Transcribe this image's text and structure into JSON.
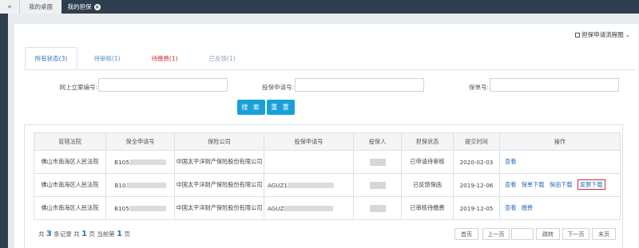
{
  "topbar": {
    "back_icon": "«",
    "home_tab": "我的桌面",
    "active_tab": "我的担保",
    "close_icon": "×"
  },
  "flow_link": "担保申请流程图",
  "status_tabs": [
    {
      "label": "所有状态(3)"
    },
    {
      "label": "待审核(1)"
    },
    {
      "label": "待缴费(1)"
    },
    {
      "label": "已反馈(1)"
    }
  ],
  "search": {
    "online_case_label": "网上立案编号:",
    "application_label": "投保申请号:",
    "policy_label": "保单号:",
    "search_button": "搜 索",
    "reset_button": "重 置"
  },
  "table": {
    "headers": [
      "管辖法院",
      "保全申请号",
      "保险公司",
      "投保申请号",
      "投保人",
      "担保状态",
      "提交时间",
      "操作"
    ],
    "rows": [
      {
        "court": "佛山市南海区人民法院",
        "preservation_no": "B105",
        "insurer": "中国太平洋财产保险股份有限公司",
        "application_no": "",
        "status": "已申请待审核",
        "date": "2020-02-03",
        "actions": [
          "查看"
        ]
      },
      {
        "court": "佛山市南海区人民法院",
        "preservation_no": "B10",
        "insurer": "中国太平洋财产保险股份有限公司",
        "application_no": "AGUZ1",
        "status": "已反馈保函",
        "date": "2019-12-06",
        "actions": [
          "查看",
          "保单下载",
          "保函下载",
          "发票下载"
        ]
      },
      {
        "court": "佛山市南海区人民法院",
        "preservation_no": "B105",
        "insurer": "中国太平洋财产保险股份有限公司",
        "application_no": "AGUZ",
        "status": "已审核待缴费",
        "date": "2019-12-05",
        "actions": [
          "查看",
          "缴费"
        ]
      }
    ]
  },
  "summary": {
    "prefix": "共",
    "total": "3",
    "records": "条记录 共",
    "pages": "1",
    "page_text": "页 当前第",
    "current": "1",
    "page_suffix": "页"
  },
  "pager": {
    "first": "首页",
    "prev": "上一页",
    "jump": "跳转",
    "next": "下一页",
    "last": "末页"
  },
  "colors": {
    "topbar": "#2f3e4e",
    "link": "#2c6fbf",
    "button": "#1aa0d8",
    "highlight": "#d32f2f",
    "red_tab": "#d0363b"
  }
}
